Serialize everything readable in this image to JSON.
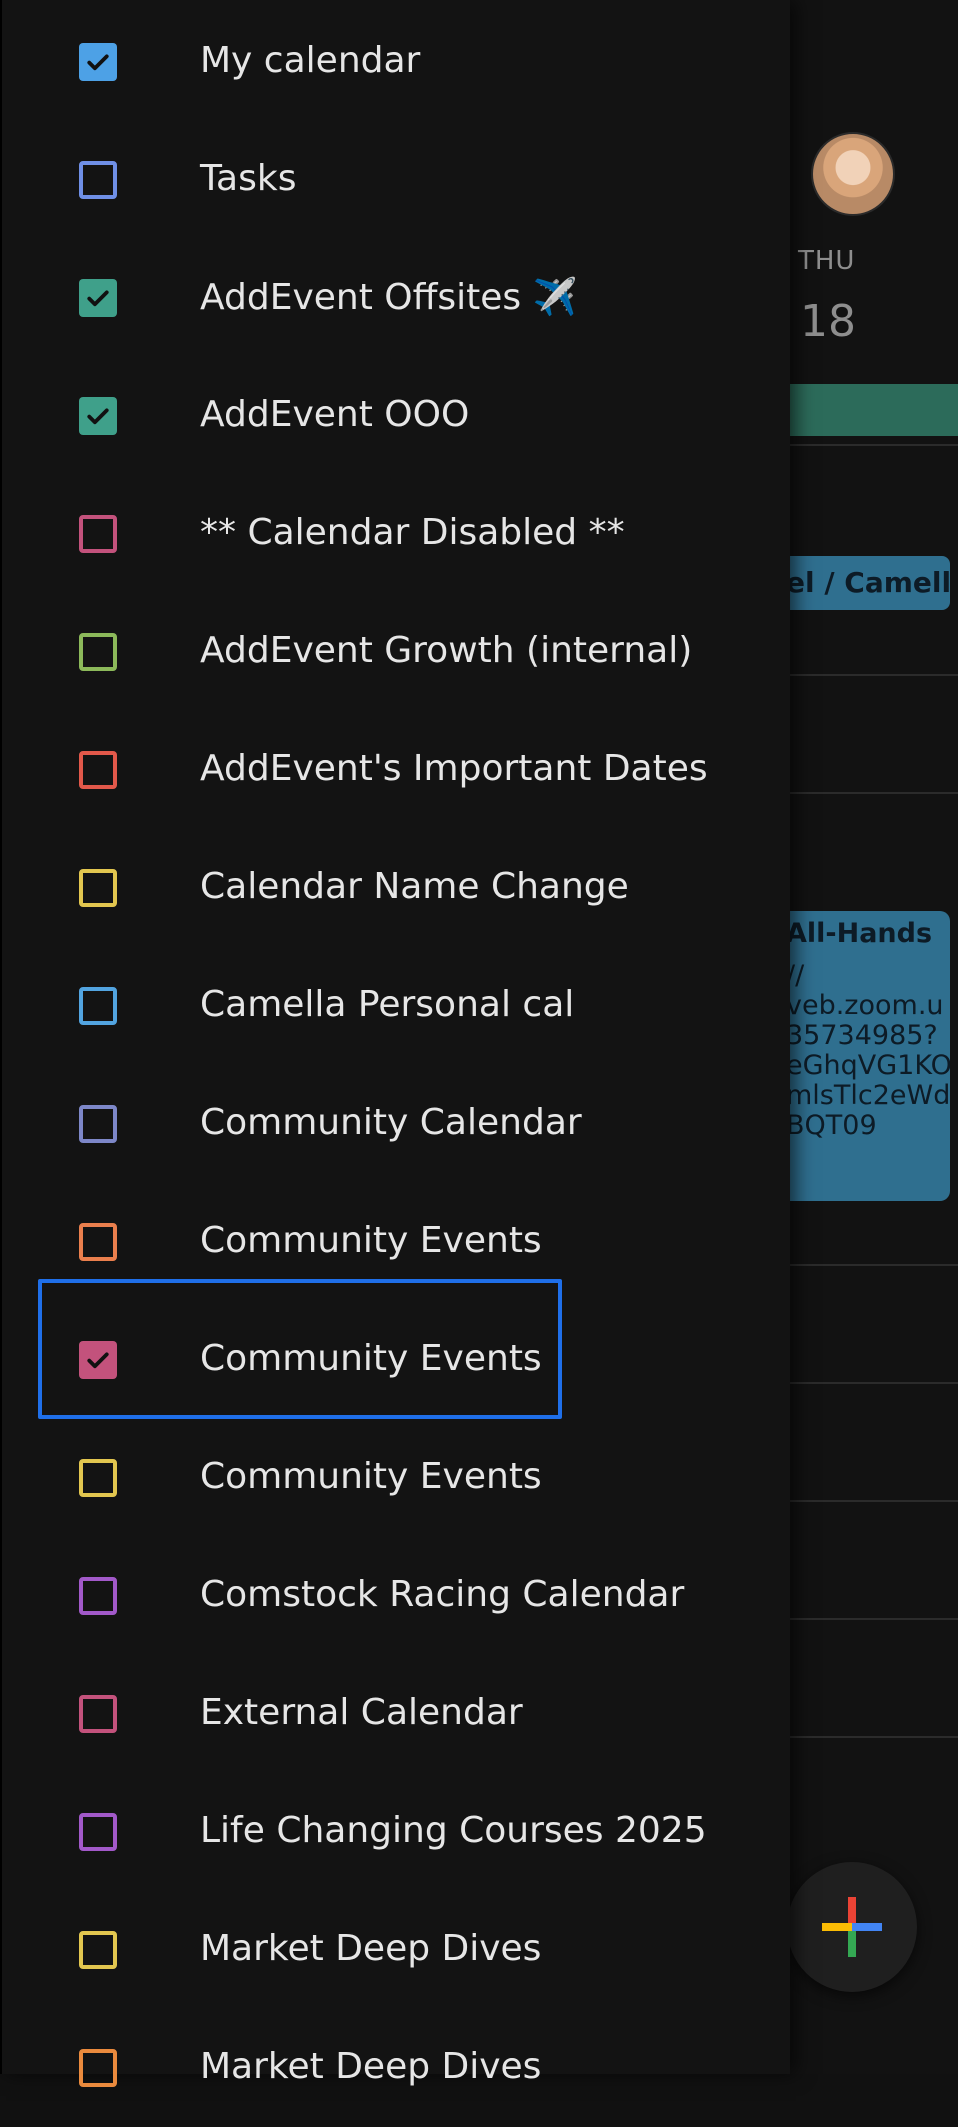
{
  "background": {
    "day_name": "THU",
    "day_number": "18",
    "event_short": "el / Camella",
    "event_long": {
      "title": "All-Hands",
      "lines": [
        "//",
        "veb.zoom.u",
        "35734985?",
        "eGhqVG1KO",
        "mlsTlc2eWd",
        "BQT09"
      ]
    },
    "fab_icon": "plus-icon"
  },
  "calendars": [
    {
      "label": "My calendar",
      "checked": true,
      "color": "#4da1e6"
    },
    {
      "label": "Tasks",
      "checked": false,
      "color": "#6f8fe6"
    },
    {
      "label": "AddEvent Offsites ✈️",
      "checked": true,
      "color": "#3fa08a"
    },
    {
      "label": "AddEvent OOO",
      "checked": true,
      "color": "#3fa08a"
    },
    {
      "label": "** Calendar Disabled **",
      "checked": false,
      "color": "#c3527c"
    },
    {
      "label": "AddEvent Growth (internal)",
      "checked": false,
      "color": "#8cb95a"
    },
    {
      "label": "AddEvent's Important Dates",
      "checked": false,
      "color": "#e2584a"
    },
    {
      "label": "Calendar Name Change",
      "checked": false,
      "color": "#e2c64f"
    },
    {
      "label": "Camella Personal cal",
      "checked": false,
      "color": "#52a4e0"
    },
    {
      "label": "Community Calendar",
      "checked": false,
      "color": "#7d87c8"
    },
    {
      "label": "Community Events",
      "checked": false,
      "color": "#ea7f4d"
    },
    {
      "label": "Community Events",
      "checked": true,
      "color": "#c3527c"
    },
    {
      "label": "Community Events",
      "checked": false,
      "color": "#e2c64f"
    },
    {
      "label": "Comstock Racing Calendar",
      "checked": false,
      "color": "#a259c9"
    },
    {
      "label": "External Calendar",
      "checked": false,
      "color": "#c3527c"
    },
    {
      "label": "Life Changing Courses 2025",
      "checked": false,
      "color": "#a259c9"
    },
    {
      "label": "Market Deep Dives",
      "checked": false,
      "color": "#e2c64f"
    },
    {
      "label": "Market Deep Dives",
      "checked": false,
      "color": "#ea8a3d"
    }
  ]
}
